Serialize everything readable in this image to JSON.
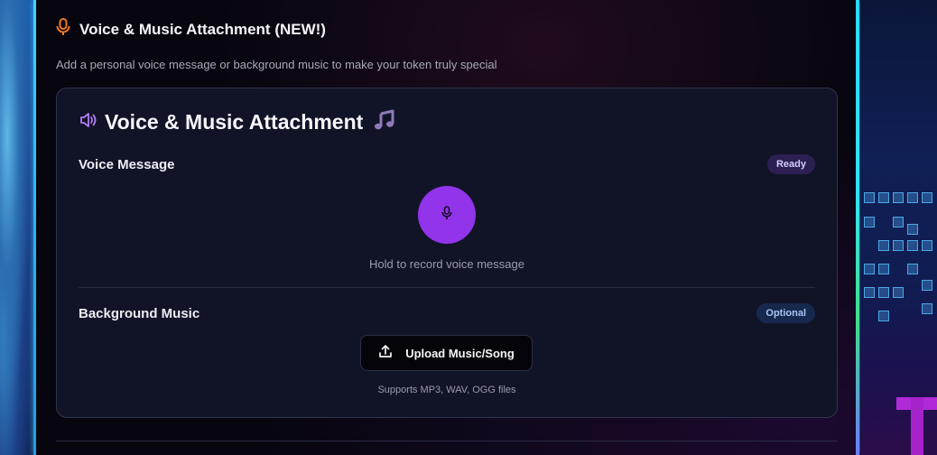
{
  "section": {
    "title": "Voice & Music Attachment (NEW!)",
    "description": "Add a personal voice message or background music to make your token truly special",
    "icon": "microphone-icon",
    "icon_color": "#f07a1e"
  },
  "card": {
    "title": "Voice & Music Attachment",
    "title_icon": "speaker-icon",
    "title_emoji": "🎵",
    "voice": {
      "label": "Voice Message",
      "badge": "Ready",
      "record_button_icon": "microphone-icon",
      "hint": "Hold to record voice message"
    },
    "music": {
      "label": "Background Music",
      "badge": "Optional",
      "upload_label": "Upload Music/Song",
      "upload_icon": "upload-icon",
      "support_text": "Supports MP3, WAV, OGG files"
    }
  },
  "colors": {
    "accent_purple": "#9234ea",
    "card_bg": "#111427",
    "page_bg": "#07060f"
  }
}
